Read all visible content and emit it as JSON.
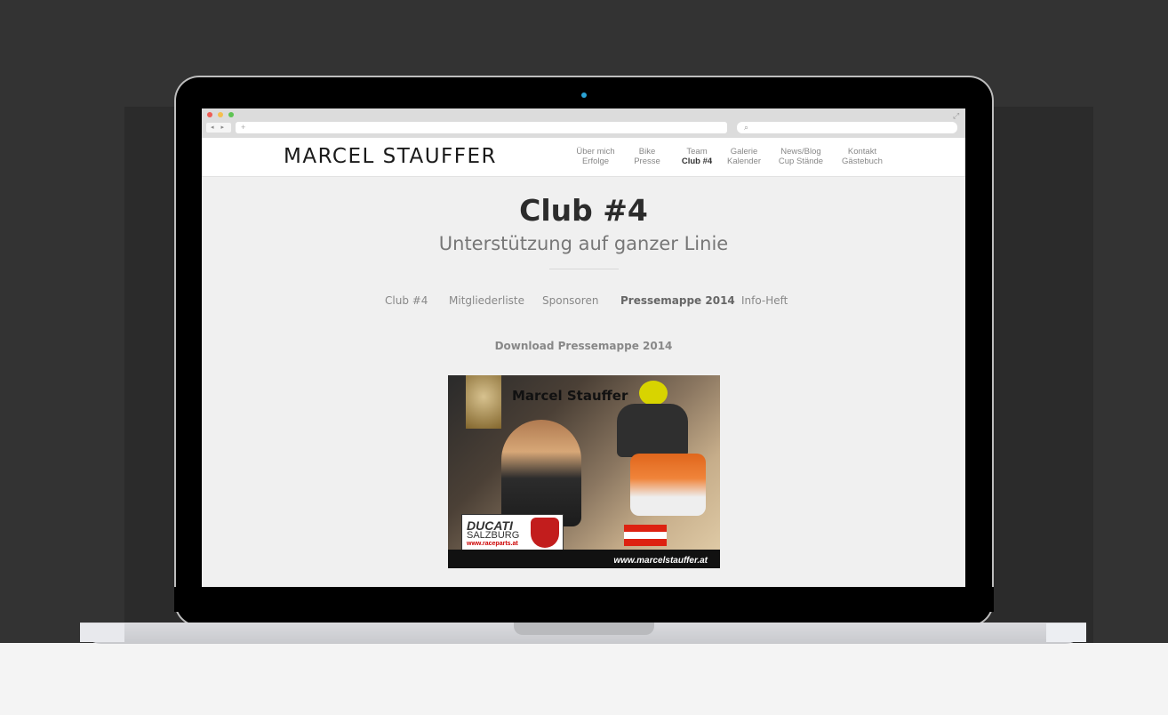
{
  "browser": {
    "url_placeholder": "+",
    "search_placeholder": "⌕",
    "nav_arrows": "◂ ▸",
    "expand_glyph": "⤢",
    "dot_colors": [
      "#ee5c54",
      "#f5bf4f",
      "#5fc454"
    ]
  },
  "site": {
    "logo": "MARCEL STAUFFER",
    "menu": [
      {
        "top": "Über mich",
        "bottom": "Erfolge"
      },
      {
        "top": "Bike",
        "bottom": "Presse"
      },
      {
        "top": "Team",
        "bottom": "Club #4",
        "active": true
      },
      {
        "top": "Galerie",
        "bottom": "Kalender"
      },
      {
        "top": "News/Blog",
        "bottom": "Cup Stände"
      },
      {
        "top": "Kontakt",
        "bottom": "Gästebuch"
      }
    ]
  },
  "page": {
    "title": "Club #4",
    "subtitle": "Unterstützung auf ganzer Linie",
    "subnav": [
      {
        "label": "Club #4"
      },
      {
        "label": "Mitgliederliste"
      },
      {
        "label": "Sponsoren"
      },
      {
        "label": "Pressemappe 2014",
        "active": true
      },
      {
        "label": "Info-Heft"
      }
    ],
    "download_link": "Download Pressemappe 2014"
  },
  "press_image": {
    "name": "Marcel Stauffer",
    "ducati_brand": "DUCATI",
    "ducati_city": "SALZBURG",
    "ducati_url": "www.raceparts.at",
    "website": "www.marcelstauffer.at"
  }
}
